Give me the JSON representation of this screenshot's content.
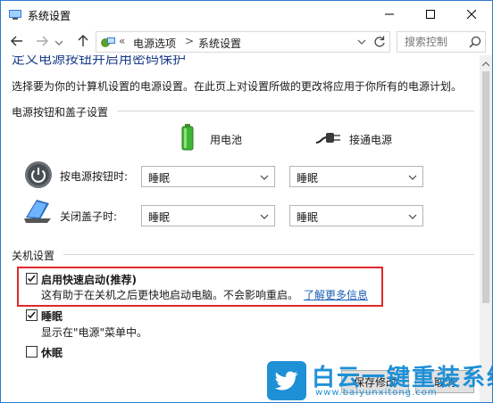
{
  "window": {
    "title": "系统设置",
    "icons": [
      "control-panel-icon",
      "minimize-icon",
      "maximize-icon",
      "close-icon"
    ]
  },
  "nav": {
    "back_icon": "back-arrow-icon",
    "forward_icon": "forward-arrow-icon",
    "recent_icon": "chevron-down-icon",
    "up_icon": "up-arrow-icon",
    "breadcrumb": {
      "overflow": "«",
      "items": [
        "电源选项",
        "系统设置"
      ],
      "separator": ">"
    },
    "search_placeholder": "搜索控制"
  },
  "page": {
    "title": "定义电源按钮并启用密码保护",
    "description": "选择要为你的计算机设置的电源设置。在此页上对设置所做的更改将应用于你所有的电源计划。",
    "power_section": {
      "heading": "电源按钮和盖子设置",
      "columns": [
        "用电池",
        "接通电源"
      ],
      "rows": [
        {
          "label": "按电源按钮时:",
          "battery": "睡眠",
          "plugged": "睡眠",
          "icon": "power-button-icon"
        },
        {
          "label": "关闭盖子时:",
          "battery": "睡眠",
          "plugged": "睡眠",
          "icon": "laptop-lid-icon"
        }
      ]
    },
    "shutdown_section": {
      "heading": "关机设置",
      "options": [
        {
          "label": "启用快速启动(推荐)",
          "checked": true,
          "bold": true,
          "desc": "这有助于在关机之后更快地启动电脑。不会影响重启。",
          "link": "了解更多信息"
        },
        {
          "label": "睡眠",
          "checked": true,
          "bold": true,
          "desc": "显示在\"电源\"菜单中。"
        },
        {
          "label": "休眠",
          "checked": false,
          "bold": true
        }
      ]
    },
    "buttons": {
      "save": "保存修改",
      "cancel": "取消"
    }
  },
  "watermark": {
    "text": "白云一键重装系统",
    "url": "www.baiyunxitong.com"
  },
  "colors": {
    "accent": "#1e3f8a",
    "highlight_border": "#e0282a",
    "link": "#1a5fb4",
    "watermark": "#1e90d6"
  }
}
